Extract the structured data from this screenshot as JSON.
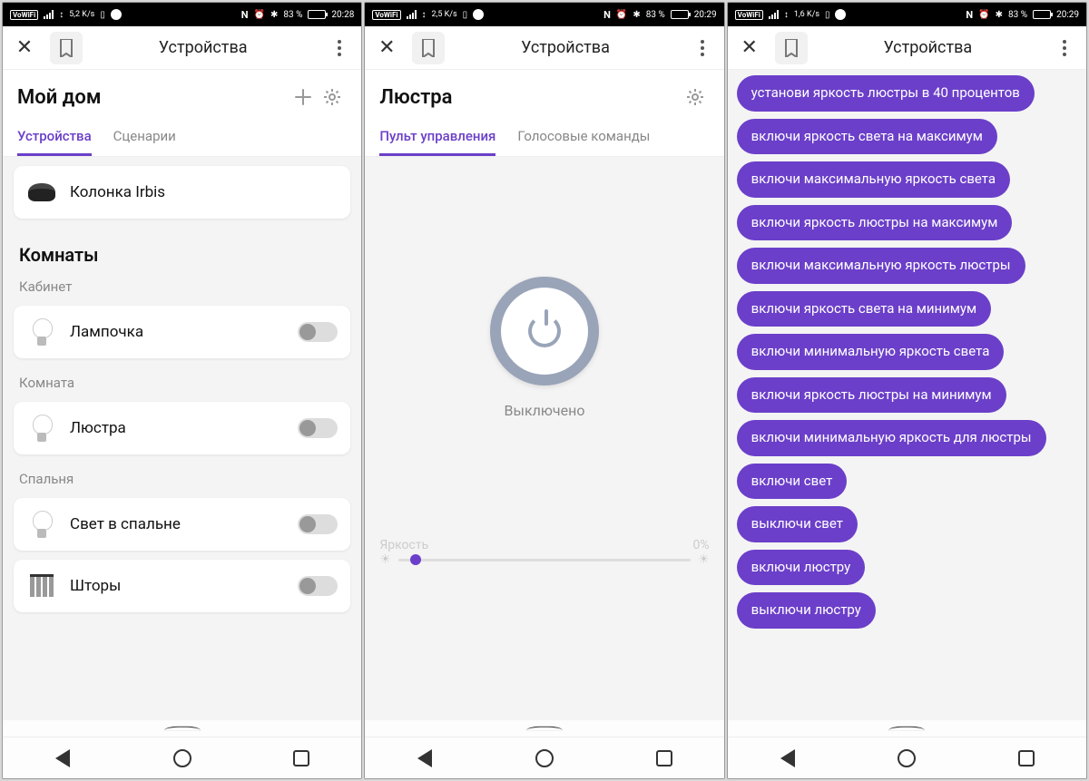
{
  "status": {
    "vowifi": "VoWiFi",
    "nfc": "N",
    "battery_pct": "83 %",
    "battery_fill": 83
  },
  "screens": [
    {
      "speed": "5,2 K/s",
      "time": "20:28",
      "app_title": "Устройства",
      "header": "Мой дом",
      "tabs": [
        "Устройства",
        "Сценарии"
      ],
      "active_tab": 0,
      "speaker": "Колонка Irbis",
      "rooms_heading": "Комнаты",
      "rooms": [
        {
          "name": "Кабинет",
          "devices": [
            {
              "label": "Лампочка",
              "type": "bulb"
            }
          ]
        },
        {
          "name": "Комната",
          "devices": [
            {
              "label": "Люстра",
              "type": "bulb"
            }
          ]
        },
        {
          "name": "Спальня",
          "devices": [
            {
              "label": "Свет в спальне",
              "type": "bulb"
            },
            {
              "label": "Шторы",
              "type": "curtain"
            }
          ]
        }
      ]
    },
    {
      "speed": "2,5 K/s",
      "time": "20:29",
      "app_title": "Устройства",
      "header": "Люстра",
      "tabs": [
        "Пульт управления",
        "Голосовые команды"
      ],
      "active_tab": 0,
      "power_status": "Выключено",
      "brightness_label": "Яркость",
      "brightness_value": "0%"
    },
    {
      "speed": "1,6 K/s",
      "time": "20:29",
      "app_title": "Устройства",
      "commands": [
        "установи яркость люстры в 40 процентов",
        "включи яркость света на максимум",
        "включи максимальную яркость света",
        "включи яркость люстры на максимум",
        "включи максимальную яркость люстры",
        "включи яркость света на минимум",
        "включи минимальную яркость света",
        "включи яркость люстры на минимум",
        "включи минимальную яркость для люстры",
        "включи свет",
        "выключи свет",
        "включи люстру",
        "выключи люстру"
      ]
    }
  ]
}
